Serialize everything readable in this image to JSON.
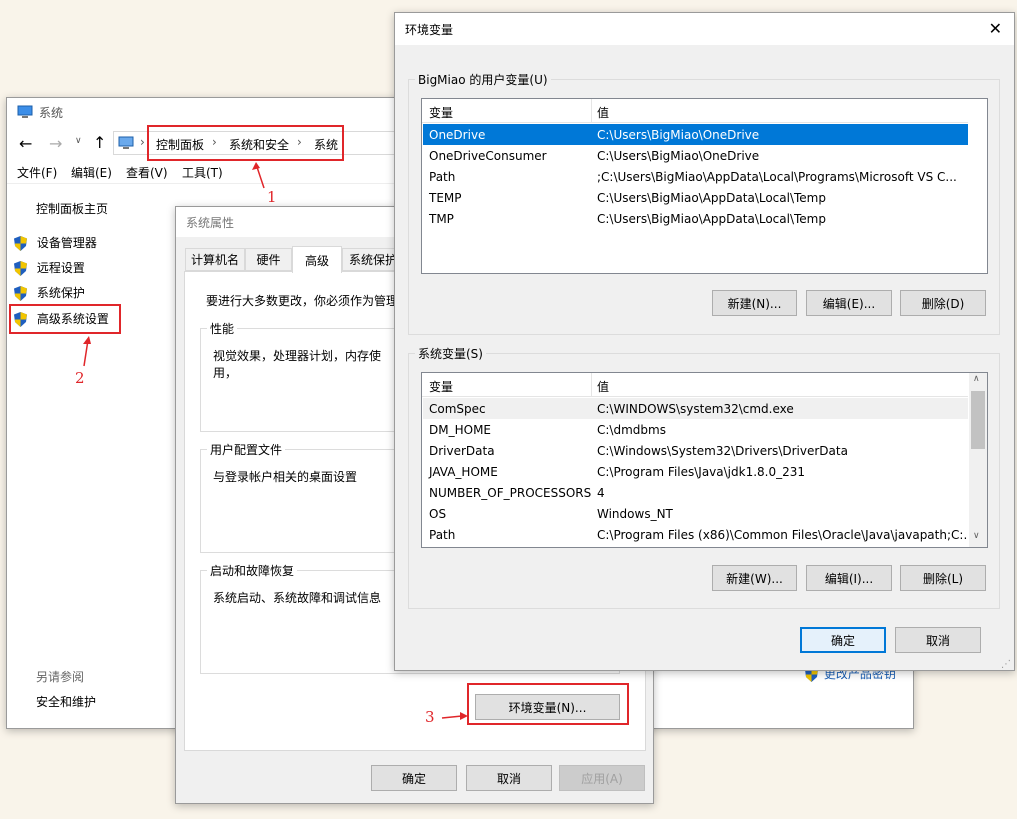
{
  "system_window": {
    "title": "系统",
    "breadcrumb": [
      "控制面板",
      "系统和安全",
      "系统"
    ],
    "menu": [
      "文件(F)",
      "编辑(E)",
      "查看(V)",
      "工具(T)"
    ],
    "sidebar_home": "控制面板主页",
    "sidebar_items": [
      "设备管理器",
      "远程设置",
      "系统保护",
      "高级系统设置"
    ],
    "see_also_title": "另请参阅",
    "see_also_items": [
      "安全和维护"
    ],
    "change_key_link": "更改产品密钥"
  },
  "sysprops": {
    "title": "系统属性",
    "tabs": [
      "计算机名",
      "硬件",
      "高级",
      "系统保护"
    ],
    "notice": "要进行大多数更改，你必须作为管理",
    "perf_label": "性能",
    "perf_desc": "视觉效果，处理器计划，内存使用，",
    "profile_label": "用户配置文件",
    "profile_desc": "与登录帐户相关的桌面设置",
    "startup_label": "启动和故障恢复",
    "startup_desc": "系统启动、系统故障和调试信息",
    "env_button": "环境变量(N)...",
    "ok": "确定",
    "cancel": "取消",
    "apply": "应用(A)"
  },
  "envvars": {
    "title": "环境变量",
    "user_group": "BigMiao 的用户变量(U)",
    "col_var": "变量",
    "col_val": "值",
    "user_vars": [
      {
        "name": "OneDrive",
        "value": "C:\\Users\\BigMiao\\OneDrive"
      },
      {
        "name": "OneDriveConsumer",
        "value": "C:\\Users\\BigMiao\\OneDrive"
      },
      {
        "name": "Path",
        "value": ";C:\\Users\\BigMiao\\AppData\\Local\\Programs\\Microsoft VS C..."
      },
      {
        "name": "TEMP",
        "value": "C:\\Users\\BigMiao\\AppData\\Local\\Temp"
      },
      {
        "name": "TMP",
        "value": "C:\\Users\\BigMiao\\AppData\\Local\\Temp"
      }
    ],
    "user_buttons": [
      "新建(N)...",
      "编辑(E)...",
      "删除(D)"
    ],
    "sys_group": "系统变量(S)",
    "sys_vars": [
      {
        "name": "ComSpec",
        "value": "C:\\WINDOWS\\system32\\cmd.exe"
      },
      {
        "name": "DM_HOME",
        "value": "C:\\dmdbms"
      },
      {
        "name": "DriverData",
        "value": "C:\\Windows\\System32\\Drivers\\DriverData"
      },
      {
        "name": "JAVA_HOME",
        "value": "C:\\Program Files\\Java\\jdk1.8.0_231"
      },
      {
        "name": "NUMBER_OF_PROCESSORS",
        "value": "4"
      },
      {
        "name": "OS",
        "value": "Windows_NT"
      },
      {
        "name": "Path",
        "value": "C:\\Program Files (x86)\\Common Files\\Oracle\\Java\\javapath;C:..."
      }
    ],
    "sys_buttons": [
      "新建(W)...",
      "编辑(I)...",
      "删除(L)"
    ],
    "ok": "确定",
    "cancel": "取消"
  },
  "annotations": [
    "1",
    "2",
    "3"
  ],
  "colors": {
    "highlight_red": "#e0262a",
    "selection_blue": "#0078d7",
    "shield_blue": "#1f5fbf",
    "shield_yellow": "#f2c500"
  }
}
